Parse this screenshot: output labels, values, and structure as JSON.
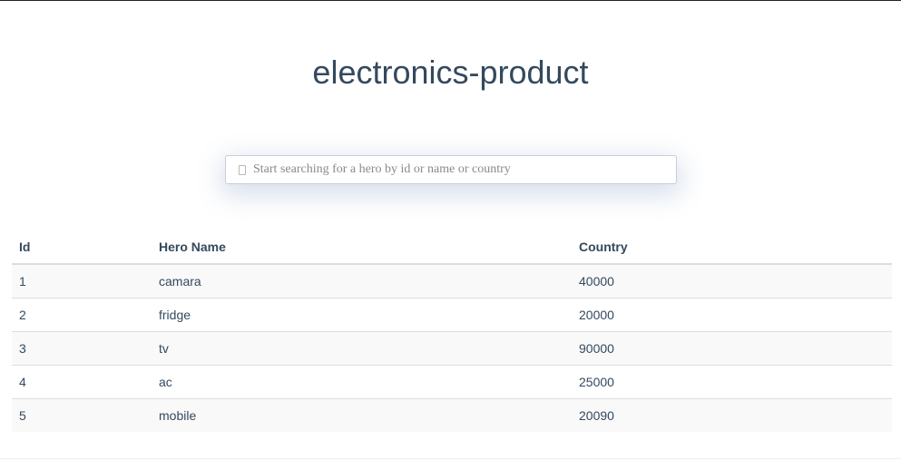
{
  "page": {
    "title": "electronics-product"
  },
  "search": {
    "placeholder": "Start searching for a hero by id or name or country",
    "icon": "search-icon"
  },
  "table": {
    "headers": {
      "id": "Id",
      "name": "Hero Name",
      "country": "Country"
    },
    "rows": [
      {
        "id": "1",
        "name": "camara",
        "country": "40000"
      },
      {
        "id": "2",
        "name": "fridge",
        "country": "20000"
      },
      {
        "id": "3",
        "name": "tv",
        "country": "90000"
      },
      {
        "id": "4",
        "name": "ac",
        "country": "25000"
      },
      {
        "id": "5",
        "name": "mobile",
        "country": "20090"
      }
    ]
  },
  "colors": {
    "text": "#34495e",
    "stripe": "#f9f9f9",
    "border": "#dddddd"
  }
}
